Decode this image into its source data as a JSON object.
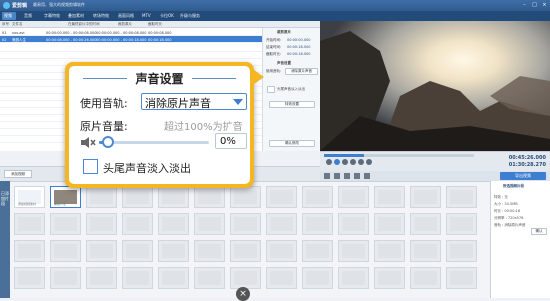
{
  "titlebar": {
    "app_name": "爱剪辑",
    "subtitle": "最易用、强大的视频剪辑软件",
    "controls": [
      "–",
      "□",
      "×"
    ]
  },
  "tabs": [
    "视频",
    "音频",
    "字幕特效",
    "叠加素材",
    "转场特效",
    "画面风格",
    "MTV",
    "卡拉OK",
    "升级与服务"
  ],
  "list": {
    "headers": [
      "序号",
      "文件名",
      "在最终影片中的时间",
      "裁剪原片",
      "截取时长"
    ],
    "rows": [
      {
        "index": "01",
        "name": "xxx.avi",
        "time": "00:00:00.000 - 00:00:08.000",
        "clip": "00:00:00.000 - 00:00:08.000",
        "dur": "00:00:08.000",
        "selected": false
      },
      {
        "index": "02",
        "name": "美丽人生",
        "time": "00:00:08.000 - 00:00:26.000",
        "clip": "00:00:00.000 - 00:00:18.000",
        "dur": "00:00:18.000",
        "selected": true
      }
    ]
  },
  "side": {
    "title": "裁剪原片",
    "labels": [
      "开始时间:",
      "结束时间:",
      "截取时长:"
    ],
    "values": [
      "00:00:00.000",
      "00:00:18.000",
      "00:00:18.000"
    ],
    "sound_title": "声音设置",
    "track_label": "使用音轨:",
    "track_value": "消除原片声音",
    "fade_label": "头尾声音淡入淡出",
    "effect_button": "特效设置",
    "confirm_button": "确认修改"
  },
  "popup": {
    "title": "声音设置",
    "track_label": "使用音轨:",
    "track_value": "消除原片声音",
    "volume_label": "原片音量:",
    "volume_hint": "超过100%为扩音",
    "volume_value": "0%",
    "volume_fraction": 0.0,
    "fade_label": "头尾声音淡入淡出",
    "fade_checked": false
  },
  "playback": {
    "current_time": "00:45:26.000",
    "total_time": "01:30:28.270",
    "export_button": "导出视频"
  },
  "lower": {
    "add_button": "添加视频"
  },
  "storyboard": {
    "side_label": "已添加片段",
    "thumb_labels": [
      "添加视频素材",
      "美丽人生",
      "",
      ""
    ]
  },
  "props": {
    "title": "所选视频片段",
    "lines": [
      "特效 : 无",
      "大小 : 34.5MB",
      "时长 : 00:00:18",
      "分辨率 : 720x576",
      "音轨 : 消除原片声音"
    ],
    "confirm": "确认"
  }
}
